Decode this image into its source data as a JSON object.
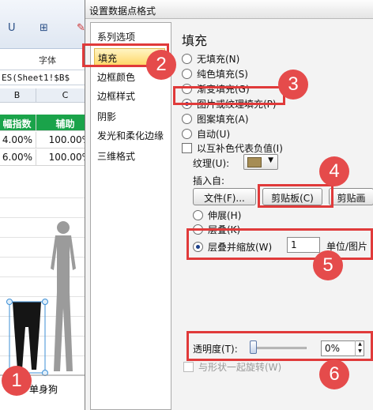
{
  "excel": {
    "ribbon_tool_1": "U",
    "ribbon_tool_2": "⊞",
    "ribbon_group_label": "字体",
    "formula_text": "ES(Sheet1!$B$",
    "columns": [
      "B",
      "C"
    ],
    "header_cells": [
      "幅指数",
      "辅助"
    ],
    "rows": [
      [
        "4.00%",
        "100.00%"
      ],
      [
        "6.00%",
        "100.00%"
      ]
    ],
    "series_label": "单身狗"
  },
  "dialog": {
    "title": "设置数据点格式",
    "nav": [
      "系列选项",
      "填充",
      "边框颜色",
      "边框样式",
      "阴影",
      "发光和柔化边缘",
      "三维格式"
    ],
    "selected_nav": "填充",
    "section_title": "填充",
    "fill_options": [
      "无填充(N)",
      "纯色填充(S)",
      "渐变填充(G)",
      "图片或纹理填充(P)",
      "图案填充(A)",
      "自动(U)"
    ],
    "selected_fill": "图片或纹理填充(P)",
    "invert_label": "以互补色代表负值(I)",
    "texture_label": "纹理(U):",
    "insert_from_label": "插入自:",
    "file_button": "文件(F)...",
    "clipboard_button": "剪贴板(C)",
    "clipart_button": "剪贴画",
    "stack_options": [
      "伸展(H)",
      "层叠(K)",
      "层叠并缩放(W)"
    ],
    "selected_stack": "层叠并缩放(W)",
    "stack_value": "1",
    "stack_unit": "单位/图片",
    "transparency_label": "透明度(T):",
    "transparency_value": "0%",
    "transparency_level": 0,
    "rotate_label": "与形状一起旋转(W)"
  },
  "annotations": {
    "badges": [
      "1",
      "2",
      "3",
      "4",
      "5",
      "6"
    ],
    "color": "#e03a3a"
  }
}
